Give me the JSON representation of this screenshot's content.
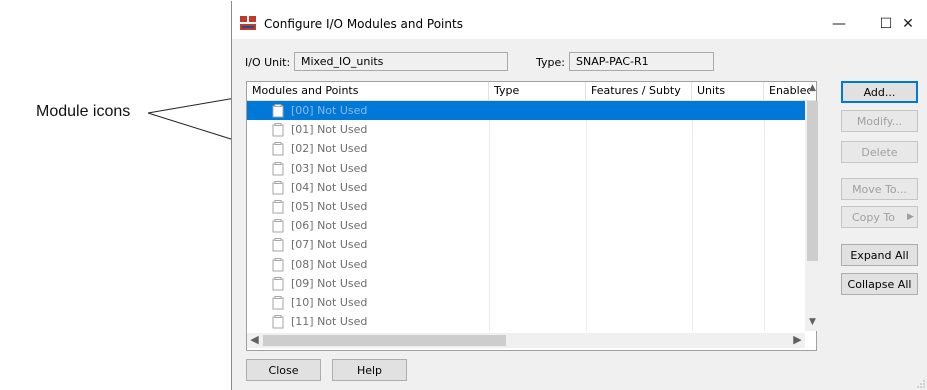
{
  "callout": {
    "label": "Module icons"
  },
  "window": {
    "title": "Configure I/O Modules and Points",
    "controls": {
      "minimize": "—",
      "maximize": "☐",
      "close": "✕"
    }
  },
  "io_unit": {
    "label": "I/O Unit:",
    "value": "Mixed_IO_units"
  },
  "type": {
    "label": "Type:",
    "value": "SNAP-PAC-R1"
  },
  "grid": {
    "columns": [
      "Modules and Points",
      "Type",
      "Features / Subty",
      "Units",
      "Enablec"
    ],
    "selected_index": 0,
    "rows": [
      "[00] Not Used",
      "[01] Not Used",
      "[02] Not Used",
      "[03] Not Used",
      "[04] Not Used",
      "[05] Not Used",
      "[06] Not Used",
      "[07] Not Used",
      "[08] Not Used",
      "[09] Not Used",
      "[10] Not Used",
      "[11] Not Used"
    ]
  },
  "buttons": {
    "add": "Add...",
    "modify": "Modify...",
    "delete": "Delete",
    "move_to": "Move To...",
    "copy_to": "Copy To",
    "expand_all": "Expand All",
    "collapse_all": "Collapse All",
    "close": "Close",
    "help": "Help"
  },
  "colors": {
    "selection": "#0078d7",
    "app_icon_red": "#c0392b"
  }
}
